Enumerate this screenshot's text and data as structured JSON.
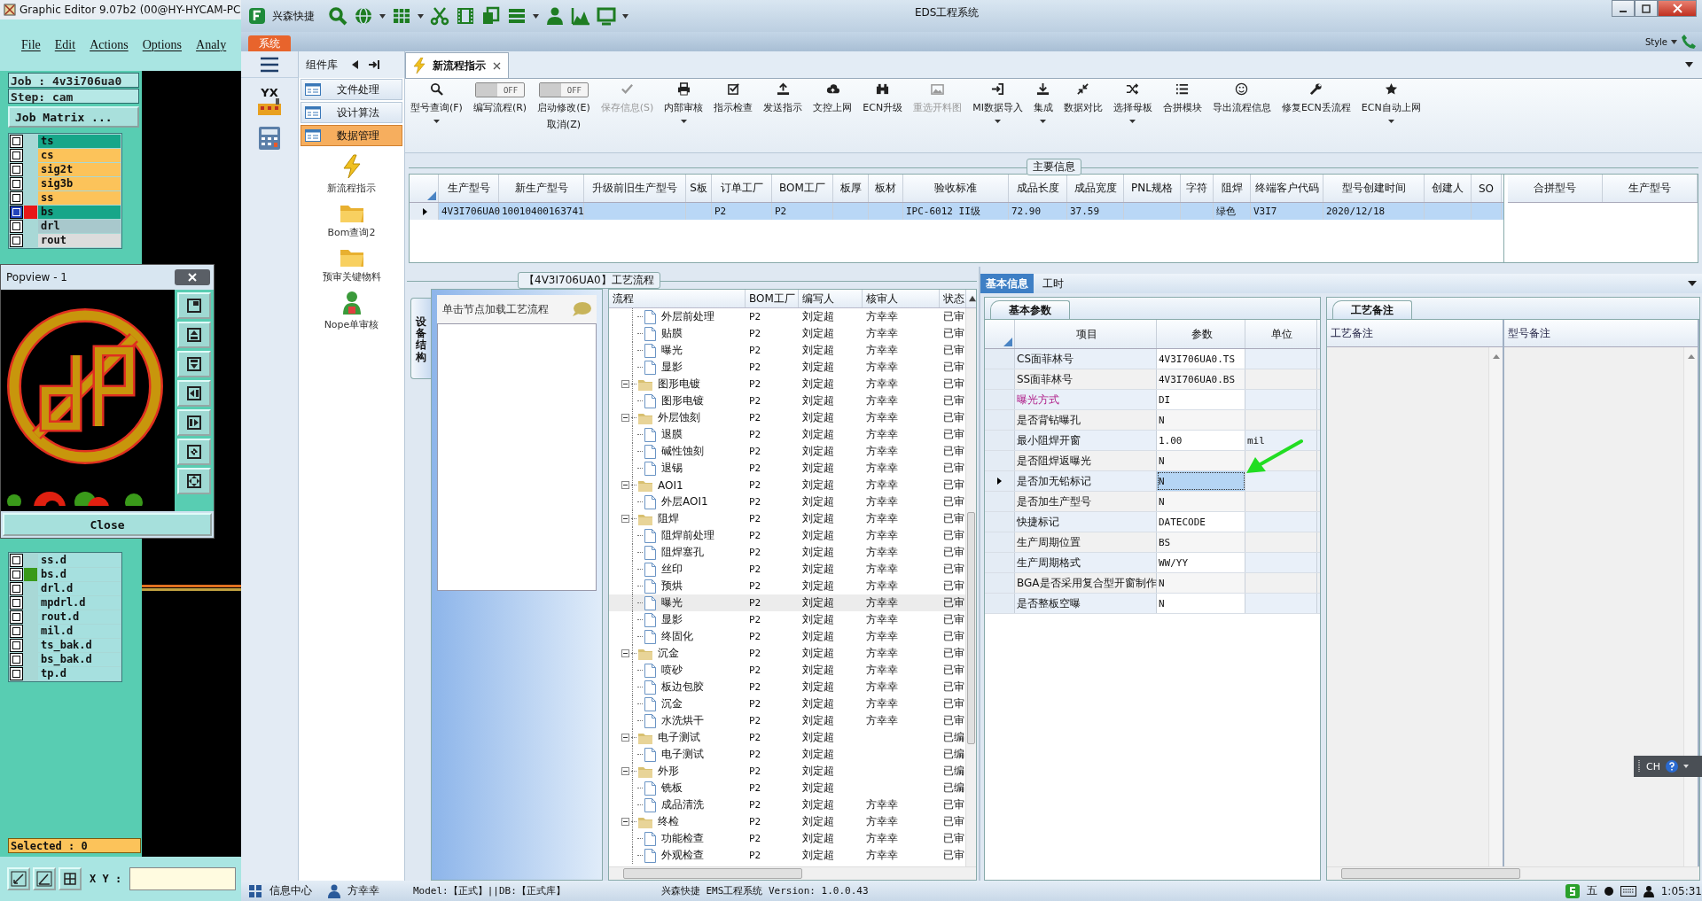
{
  "genesis": {
    "title": "Graphic Editor 9.07b2 (00@HY-HYCAM-PC",
    "menu": [
      "File",
      "Edit",
      "Actions",
      "Options",
      "Analy"
    ],
    "job": "Job : 4v3i706ua0",
    "step": "Step: cam",
    "matrix_button": "Job Matrix ...",
    "layers": [
      {
        "name": "ts",
        "color": "#17a689",
        "selected": false
      },
      {
        "name": "cs",
        "color": "#fcc35a",
        "selected": false
      },
      {
        "name": "sig2t",
        "color": "#fcc35a",
        "selected": false
      },
      {
        "name": "sig3b",
        "color": "#fcc35a",
        "selected": false
      },
      {
        "name": "ss",
        "color": "#fcc35a",
        "selected": false
      },
      {
        "name": "bs",
        "color": "#17a689",
        "selected": true
      },
      {
        "name": "drl",
        "color": "#a8c8cc",
        "selected": false
      },
      {
        "name": "rout",
        "color": "#dcdcdc",
        "selected": false
      }
    ],
    "drill_layers": [
      {
        "name": "ss.d",
        "marked": false,
        "checked": false
      },
      {
        "name": "bs.d",
        "marked": true,
        "checked": false
      },
      {
        "name": "drl.d",
        "marked": false,
        "checked": false
      },
      {
        "name": "mpdrl.d",
        "marked": false,
        "checked": false
      },
      {
        "name": "rout.d",
        "marked": false,
        "checked": false
      },
      {
        "name": "mil.d",
        "marked": false,
        "checked": false
      },
      {
        "name": "ts_bak.d",
        "marked": false,
        "checked": false
      },
      {
        "name": "bs_bak.d",
        "marked": false,
        "checked": false
      },
      {
        "name": "tp.d",
        "marked": false,
        "checked": false
      }
    ],
    "selected_count": "Selected : 0",
    "xy_label": "X Y :"
  },
  "popview": {
    "title": "Popview - 1",
    "close_button": "Close"
  },
  "window": {
    "app_name": "兴森快捷",
    "title": "EDS工程系统",
    "style_label": "Style"
  },
  "menu_tab": "系统",
  "nav": {
    "logo_text": "YX"
  },
  "component_panel": {
    "title": "组件库",
    "groups": [
      {
        "label": "文件处理",
        "selected": false
      },
      {
        "label": "设计算法",
        "selected": false
      },
      {
        "label": "数据管理",
        "selected": true
      }
    ],
    "items": [
      "新流程指示",
      "Bom查询2",
      "预审关键物料",
      "Nope单审核"
    ]
  },
  "doc_tab": {
    "label": "新流程指示"
  },
  "ribbon": [
    {
      "kind": "button",
      "label": "型号查询(F)",
      "dropdown": true,
      "disabled": false
    },
    {
      "kind": "toggle",
      "label": "编写流程(R)",
      "state_text": "OFF",
      "on": false
    },
    {
      "kind": "toggle",
      "label": "启动修改(E)",
      "state_text": "OFF",
      "on": false,
      "sub_label": "取消(Z)"
    },
    {
      "kind": "button",
      "label": "保存信息(S)",
      "dropdown": false,
      "disabled": true
    },
    {
      "kind": "button",
      "label": "内部审核",
      "dropdown": true,
      "disabled": false
    },
    {
      "kind": "button",
      "label": "指示检查",
      "dropdown": false,
      "disabled": false
    },
    {
      "kind": "button",
      "label": "发送指示",
      "dropdown": false,
      "disabled": false
    },
    {
      "kind": "button",
      "label": "文控上网",
      "dropdown": false,
      "disabled": false
    },
    {
      "kind": "button",
      "label": "ECN升级",
      "dropdown": false,
      "disabled": false
    },
    {
      "kind": "button",
      "label": "重选开料图",
      "dropdown": false,
      "disabled": true
    },
    {
      "kind": "button",
      "label": "MI数据导入",
      "dropdown": true,
      "disabled": false
    },
    {
      "kind": "button",
      "label": "集成",
      "dropdown": true,
      "disabled": false
    },
    {
      "kind": "button",
      "label": "数据对比",
      "dropdown": false,
      "disabled": false
    },
    {
      "kind": "button",
      "label": "选择母板",
      "dropdown": true,
      "disabled": false
    },
    {
      "kind": "button",
      "label": "合拼模块",
      "dropdown": false,
      "disabled": false
    },
    {
      "kind": "button",
      "label": "导出流程信息",
      "dropdown": false,
      "disabled": false
    },
    {
      "kind": "button",
      "label": "修复ECN丢流程",
      "dropdown": false,
      "disabled": false
    },
    {
      "kind": "button",
      "label": "ECN自动上网",
      "dropdown": true,
      "disabled": false
    }
  ],
  "main_info": {
    "title": "主要信息",
    "columns": [
      "生产型号",
      "新生产型号",
      "升级前旧生产型号",
      "S板",
      "订单工厂",
      "BOM工厂",
      "板厚",
      "板材",
      "验收标准",
      "成品长度",
      "成品宽度",
      "PNL规格",
      "字符",
      "阻焊",
      "终端客户代码",
      "型号创建时间",
      "创建人",
      "SO"
    ],
    "rows": [
      {
        "selected": true,
        "cells": [
          "4V3I706UA0",
          "10010400163741",
          null,
          null,
          "P2",
          "P2",
          null,
          null,
          "IPC-6012 II级",
          "72.90",
          "37.59",
          null,
          null,
          "绿色",
          "V3I7",
          "2020/12/18",
          null,
          null
        ]
      }
    ],
    "side_columns": [
      "合拼型号",
      "生产型号"
    ]
  },
  "process": {
    "title": "【4V3I706UA0】工艺流程",
    "side_tab": "设备结构",
    "hint": "单击节点加载工艺流程",
    "columns": [
      "流程",
      "BOM工厂",
      "编写人",
      "核审人",
      "状态"
    ],
    "tree": [
      {
        "children": [
          {
            "label": "外层前处理",
            "bom": "P2",
            "writer": "刘定超",
            "reviewer": "方幸幸",
            "status": "已审",
            "selected": false
          },
          {
            "label": "贴膜",
            "bom": "P2",
            "writer": "刘定超",
            "reviewer": "方幸幸",
            "status": "已审",
            "selected": false
          },
          {
            "label": "曝光",
            "bom": "P2",
            "writer": "刘定超",
            "reviewer": "方幸幸",
            "status": "已审",
            "selected": false
          },
          {
            "label": "显影",
            "bom": "P2",
            "writer": "刘定超",
            "reviewer": "方幸幸",
            "status": "已审",
            "selected": false
          }
        ]
      },
      {
        "label": "图形电镀",
        "bom": "P2",
        "writer": "刘定超",
        "reviewer": "方幸幸",
        "status": "已审",
        "selected": false,
        "expanded": true,
        "children": [
          {
            "label": "图形电镀",
            "bom": "P2",
            "writer": "刘定超",
            "reviewer": "方幸幸",
            "status": "已审",
            "selected": false
          }
        ]
      },
      {
        "label": "外层蚀刻",
        "bom": "P2",
        "writer": "刘定超",
        "reviewer": "方幸幸",
        "status": "已审",
        "selected": false,
        "expanded": true,
        "children": [
          {
            "label": "退膜",
            "bom": "P2",
            "writer": "刘定超",
            "reviewer": "方幸幸",
            "status": "已审",
            "selected": false
          },
          {
            "label": "碱性蚀刻",
            "bom": "P2",
            "writer": "刘定超",
            "reviewer": "方幸幸",
            "status": "已审",
            "selected": false
          },
          {
            "label": "退锡",
            "bom": "P2",
            "writer": "刘定超",
            "reviewer": "方幸幸",
            "status": "已审",
            "selected": false
          }
        ]
      },
      {
        "label": "AOI1",
        "bom": "P2",
        "writer": "刘定超",
        "reviewer": "方幸幸",
        "status": "已审",
        "selected": false,
        "expanded": true,
        "children": [
          {
            "label": "外层AOI1",
            "bom": "P2",
            "writer": "刘定超",
            "reviewer": "方幸幸",
            "status": "已审",
            "selected": false
          }
        ]
      },
      {
        "label": "阻焊",
        "bom": "P2",
        "writer": "刘定超",
        "reviewer": "方幸幸",
        "status": "已审",
        "selected": false,
        "expanded": true,
        "children": [
          {
            "label": "阻焊前处理",
            "bom": "P2",
            "writer": "刘定超",
            "reviewer": "方幸幸",
            "status": "已审",
            "selected": false
          },
          {
            "label": "阻焊塞孔",
            "bom": "P2",
            "writer": "刘定超",
            "reviewer": "方幸幸",
            "status": "已审",
            "selected": false
          },
          {
            "label": "丝印",
            "bom": "P2",
            "writer": "刘定超",
            "reviewer": "方幸幸",
            "status": "已审",
            "selected": false
          },
          {
            "label": "预烘",
            "bom": "P2",
            "writer": "刘定超",
            "reviewer": "方幸幸",
            "status": "已审",
            "selected": false
          },
          {
            "label": "曝光",
            "bom": "P2",
            "writer": "刘定超",
            "reviewer": "方幸幸",
            "status": "已审",
            "selected": true
          },
          {
            "label": "显影",
            "bom": "P2",
            "writer": "刘定超",
            "reviewer": "方幸幸",
            "status": "已审",
            "selected": false
          },
          {
            "label": "终固化",
            "bom": "P2",
            "writer": "刘定超",
            "reviewer": "方幸幸",
            "status": "已审",
            "selected": false
          }
        ]
      },
      {
        "label": "沉金",
        "bom": "P2",
        "writer": "刘定超",
        "reviewer": "方幸幸",
        "status": "已审",
        "selected": false,
        "expanded": true,
        "children": [
          {
            "label": "喷砂",
            "bom": "P2",
            "writer": "刘定超",
            "reviewer": "方幸幸",
            "status": "已审",
            "selected": false
          },
          {
            "label": "板边包胶",
            "bom": "P2",
            "writer": "刘定超",
            "reviewer": "方幸幸",
            "status": "已审",
            "selected": false
          },
          {
            "label": "沉金",
            "bom": "P2",
            "writer": "刘定超",
            "reviewer": "方幸幸",
            "status": "已审",
            "selected": false
          },
          {
            "label": "水洗烘干",
            "bom": "P2",
            "writer": "刘定超",
            "reviewer": "方幸幸",
            "status": "已审",
            "selected": false
          }
        ]
      },
      {
        "label": "电子测试",
        "bom": "P2",
        "writer": "刘定超",
        "status": "已编",
        "selected": false,
        "expanded": true,
        "children": [
          {
            "label": "电子测试",
            "bom": "P2",
            "writer": "刘定超",
            "status": "已编",
            "selected": false
          }
        ]
      },
      {
        "label": "外形",
        "bom": "P2",
        "writer": "刘定超",
        "status": "已编",
        "selected": false,
        "expanded": true,
        "children": [
          {
            "label": "铣板",
            "bom": "P2",
            "writer": "刘定超",
            "status": "已编",
            "selected": false
          },
          {
            "label": "成品清洗",
            "bom": "P2",
            "writer": "刘定超",
            "reviewer": "方幸幸",
            "status": "已审",
            "selected": false
          }
        ]
      },
      {
        "label": "终检",
        "bom": "P2",
        "writer": "刘定超",
        "reviewer": "方幸幸",
        "status": "已审",
        "selected": false,
        "expanded": true,
        "children": [
          {
            "label": "功能检查",
            "bom": "P2",
            "writer": "刘定超",
            "reviewer": "方幸幸",
            "status": "已审",
            "selected": false
          },
          {
            "label": "外观检查",
            "bom": "P2",
            "writer": "刘定超",
            "reviewer": "方幸幸",
            "status": "已审",
            "selected": false
          }
        ]
      }
    ]
  },
  "detail": {
    "tabs": [
      {
        "label": "基本信息",
        "selected": true
      },
      {
        "label": "工时",
        "selected": false
      }
    ],
    "params_tab": "基本参数",
    "param_columns": [
      "项目",
      "参数",
      "单位"
    ],
    "params": [
      {
        "item": "CS面菲林号",
        "value": "4V3I706UA0.TS",
        "flagged": false,
        "selected": false
      },
      {
        "item": "SS面菲林号",
        "value": "4V3I706UA0.BS",
        "flagged": false,
        "selected": false
      },
      {
        "item": "曝光方式",
        "value": "DI",
        "flagged": true,
        "selected": false
      },
      {
        "item": "是否背钻曝孔",
        "value": "N",
        "flagged": false,
        "selected": false
      },
      {
        "item": "最小阻焊开窗",
        "value": "1.00",
        "unit": "mil",
        "flagged": false,
        "selected": false
      },
      {
        "item": "是否阻焊返曝光",
        "value": "N",
        "flagged": false,
        "selected": false
      },
      {
        "item": "是否加无铅标记",
        "value": "N",
        "flagged": false,
        "selected": true
      },
      {
        "item": "是否加生产型号",
        "value": "N",
        "flagged": false,
        "selected": false
      },
      {
        "item": "快捷标记",
        "value": "DATECODE",
        "flagged": false,
        "selected": false
      },
      {
        "item": "生产周期位置",
        "value": "BS",
        "flagged": false,
        "selected": false
      },
      {
        "item": "生产周期格式",
        "value": "WW/YY",
        "flagged": false,
        "selected": false
      },
      {
        "item": "BGA是否采用复合型开窗制作",
        "value": "N",
        "flagged": false,
        "selected": false
      },
      {
        "item": "是否整板空曝",
        "value": "N",
        "flagged": false,
        "selected": false
      }
    ],
    "notes_tab": "工艺备注",
    "note_columns": [
      "工艺备注",
      "型号备注"
    ]
  },
  "status_bar": {
    "items": [
      "信息中心",
      "方幸幸"
    ],
    "model": "Model:【正式】||DB:【正式库】",
    "version": "兴森快捷 EMS工程系统 Version: 1.0.0.43"
  },
  "tray": {
    "ime_mark": "五",
    "time": "1:05:31",
    "language": "CH"
  }
}
